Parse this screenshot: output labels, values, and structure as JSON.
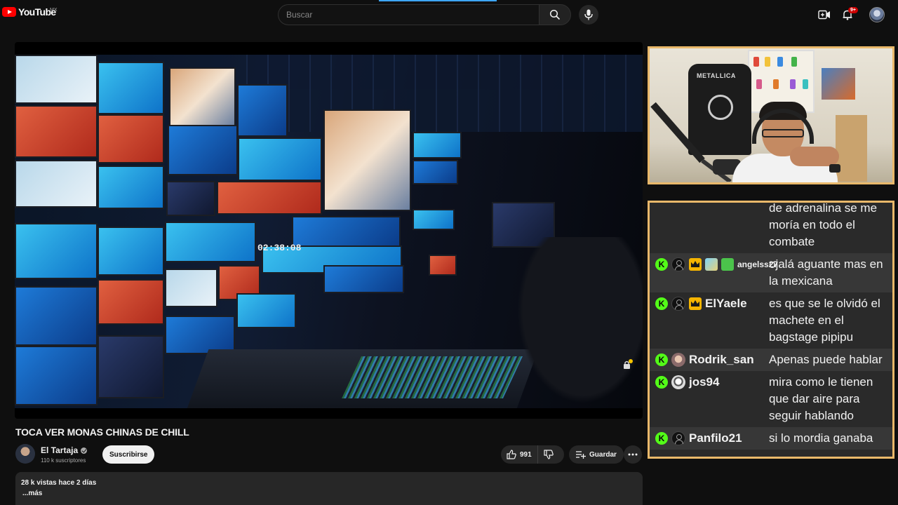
{
  "header": {
    "logo_text": "YouTube",
    "region": "MX",
    "search_placeholder": "Buscar",
    "notification_count": "9+",
    "accent_color": "#ff0000"
  },
  "player": {
    "timecode_overlay": "02:38:08"
  },
  "video": {
    "title": "TOCA VER MONAS CHINAS DE CHILL",
    "channel_name": "El Tartaja",
    "subscribers": "110 k suscriptores",
    "subscribe_label": "Suscribirse",
    "likes": "991",
    "save_label": "Guardar",
    "views_date": "28 k vistas  hace 2 días",
    "more_label": "...más"
  },
  "cam": {
    "jersey_text": "METALLICA",
    "frame_color": "#e9b86a"
  },
  "chat": {
    "messages": [
      {
        "user": "",
        "text": "de adrenalina se me moría en todo el combate"
      },
      {
        "user": "angelss27",
        "text": "ojalá aguante mas en la mexicana"
      },
      {
        "user": "ElYaele",
        "text": "es que se le olvidó el machete en el bagstage pipipu"
      },
      {
        "user": "Rodrik_san",
        "text": "Apenas puede hablar"
      },
      {
        "user": "jos94",
        "text": "mira como le tienen que dar aire para seguir hablando"
      },
      {
        "user": "Panfilo21",
        "text": "si lo mordia ganaba"
      }
    ]
  }
}
